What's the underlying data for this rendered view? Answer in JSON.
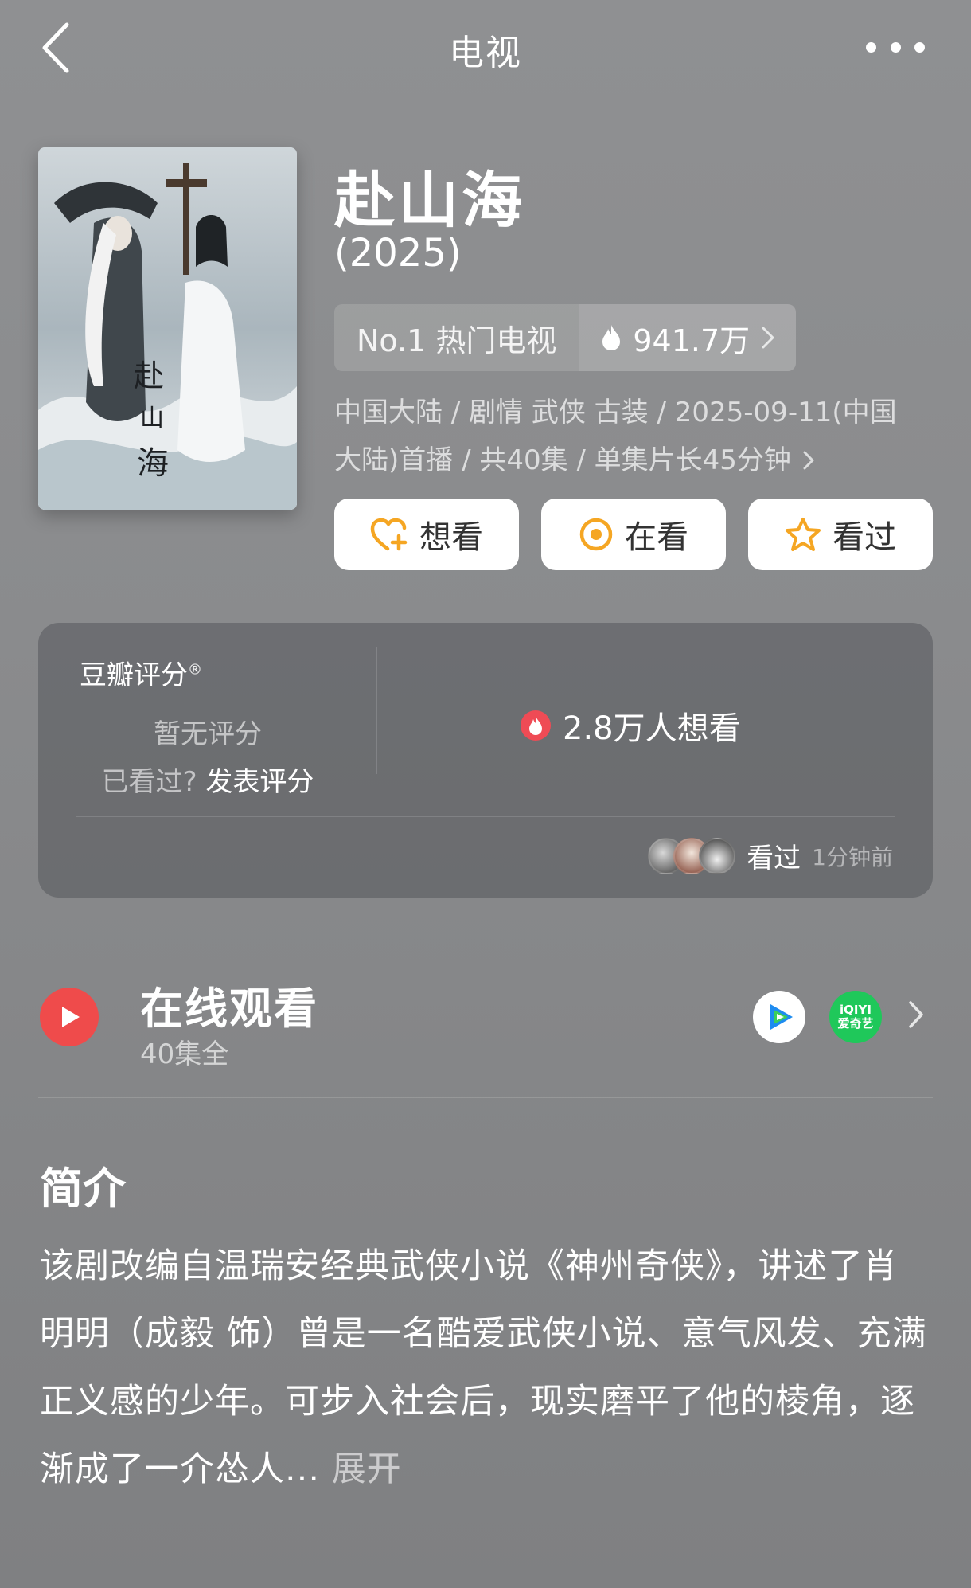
{
  "header": {
    "title": "电视"
  },
  "show": {
    "title": "赴山海",
    "year": "(2025)",
    "rank_label": "No.1 热门电视",
    "heat_value": "941.7万",
    "meta_line1": "中国大陆 / 剧情 武侠 古装 / 2025-09-11(中国",
    "meta_line2": "大陆)首播 / 共40集 / 单集片长45分钟"
  },
  "actions": [
    {
      "label": "想看",
      "icon": "heart-plus-icon"
    },
    {
      "label": "在看",
      "icon": "target-icon"
    },
    {
      "label": "看过",
      "icon": "star-icon"
    }
  ],
  "rating": {
    "heading": "豆瓣评分",
    "heading_mark": "®",
    "no_rating": "暂无评分",
    "seen_question": "已看过?",
    "rate_link": "发表评分",
    "want_count": "2.8万人想看",
    "seen_label": "看过",
    "seen_time": "1分钟前"
  },
  "watch": {
    "title": "在线观看",
    "subtitle": "40集全",
    "platforms": [
      "tencent-video-icon",
      "iqiyi-icon"
    ],
    "iqiyi_line1": "iQIYI",
    "iqiyi_line2": "爱奇艺"
  },
  "intro": {
    "heading": "简介",
    "text": "该剧改编自温瑞安经典武侠小说《神州奇侠》，讲述了肖明明（成毅 饰）曾是一名酷爱武侠小说、意气风发、充满正义感的少年。可步入社会后，现实磨平了他的棱角，逐渐成了一介怂人...",
    "expand": "展开"
  },
  "colors": {
    "background": "#8c8d8f",
    "accent_orange": "#f5a623",
    "play_red": "#ef4b4b",
    "iqiyi_green": "#1fc85a"
  }
}
